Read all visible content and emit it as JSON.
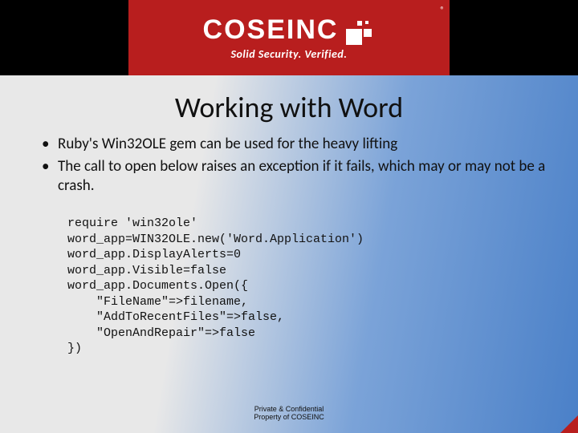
{
  "header": {
    "brand": "COSEINC",
    "registered": "®",
    "tagline": "Solid Security. Verified."
  },
  "title": "Working with Word",
  "bullets": [
    "Ruby's Win32OLE gem can be used for the heavy lifting",
    "The call to open below raises an exception if it fails, which may or may not be a crash."
  ],
  "code": "require 'win32ole'\nword_app=WIN32OLE.new('Word.Application')\nword_app.DisplayAlerts=0\nword_app.Visible=false\nword_app.Documents.Open({\n    \"FileName\"=>filename,\n    \"AddToRecentFiles\"=>false,\n    \"OpenAndRepair\"=>false\n})",
  "footer": {
    "line1": "Private & Confidential",
    "line2": "Property of COSEINC"
  }
}
